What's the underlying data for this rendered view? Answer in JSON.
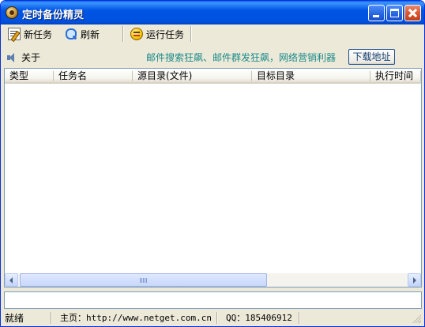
{
  "window": {
    "title": "定时备份精灵"
  },
  "toolbar": {
    "new_task_label": "新任务",
    "refresh_label": "刷新",
    "run_task_label": "运行任务"
  },
  "infobar": {
    "about_label": "关于",
    "promo_text": "邮件搜索狂飙、邮件群发狂飙，网络营销利器",
    "download_label": "下载地址"
  },
  "list": {
    "columns": [
      "类型",
      "任务名",
      "源目录(文件)",
      "目标目录",
      "执行时间"
    ],
    "rows": []
  },
  "statusbar": {
    "status": "就绪",
    "homepage": "主页：http://www.netget.com.cn",
    "qq": "QQ：185406912"
  },
  "icons": {
    "app": "app-icon",
    "new_task": "edit-note-icon",
    "refresh": "magnifier-icon",
    "run_task": "smiley-icon",
    "about": "speaker-icon"
  }
}
